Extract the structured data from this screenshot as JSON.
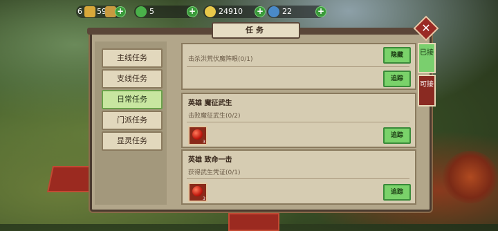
{
  "resources": [
    {
      "name": "level-badge",
      "value": "6"
    },
    {
      "name": "gold-ingot",
      "value": "59",
      "icon": "gold-ingot-icon"
    },
    {
      "name": "jade",
      "value": "5",
      "icon": "jade-icon"
    },
    {
      "name": "coins",
      "value": "24910",
      "icon": "coin-icon"
    },
    {
      "name": "spirit",
      "value": "22",
      "icon": "spirit-gem-icon"
    }
  ],
  "window": {
    "title": "任务"
  },
  "left_tabs": [
    "主线任务",
    "支线任务",
    "日常任务",
    "门派任务",
    "显灵任务"
  ],
  "active_tab_index": 2,
  "right_tabs": [
    {
      "label": "已接",
      "active": true
    },
    {
      "label": "可接",
      "active": false
    }
  ],
  "quests": [
    {
      "name": "",
      "desc": "击杀洪荒伏魔阵眼(0/1)",
      "buttons": [
        "隐藏",
        "追踪"
      ],
      "reward": null
    },
    {
      "name": "英雄 魔征武生",
      "desc": "击败魔征武生(0/2)",
      "buttons": [
        "追踪"
      ],
      "reward": {
        "count": "3"
      }
    },
    {
      "name": "英雄 致命一击",
      "desc": "获得武生凭证(0/1)",
      "buttons": [
        "追踪"
      ],
      "reward": {
        "count": "3"
      }
    }
  ],
  "colors": {
    "accent_green": "#7ad26a",
    "panel": "#b2a68a",
    "close_red": "#9a2a24"
  }
}
